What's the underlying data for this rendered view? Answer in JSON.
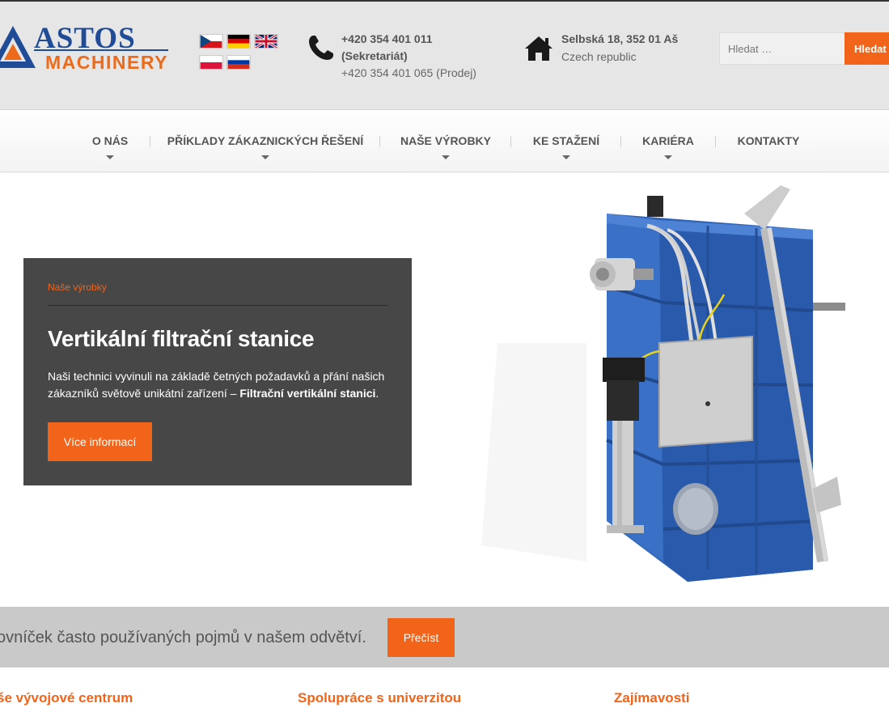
{
  "header": {
    "logo": {
      "line1": "ASTOS",
      "line2": "MACHINERY"
    },
    "flags": [
      "cz",
      "de",
      "gb",
      "pl",
      "ru"
    ],
    "phone": {
      "line1": "+420 354 401 011",
      "line2": "(Sekretariát)",
      "line3": "+420 354 401 065 (Prodej)"
    },
    "address": {
      "line1": "Selbská 18, 352 01 Aš",
      "line2": "Czech republic"
    },
    "search": {
      "placeholder": "Hledat …",
      "button": "Hledat"
    }
  },
  "nav": {
    "items": [
      {
        "label": "O NÁS",
        "dropdown": true
      },
      {
        "label": "PŘÍKLADY ZÁKAZNICKÝCH ŘEŠENÍ",
        "dropdown": true
      },
      {
        "label": "NAŠE VÝROBKY",
        "dropdown": true
      },
      {
        "label": "KE STAŽENÍ",
        "dropdown": true
      },
      {
        "label": "KARIÉRA",
        "dropdown": true
      },
      {
        "label": "KONTAKTY",
        "dropdown": false
      }
    ]
  },
  "hero": {
    "category": "Naše výrobky",
    "title": "Vertikální filtrační stanice",
    "text": "Naši technici vyvinuli na základě četných požadavků a přání našich zákazníků světově unikátní zařízení – ",
    "text_bold": "Filtrační vertikální stanici",
    "text_end": ".",
    "button": "Více informací"
  },
  "strip": {
    "text": "ovníček často používaných pojmů v našem odvětví.",
    "button": "Přečíst"
  },
  "footer_headings": [
    "še vývojové centrum",
    "Spolupráce s univerzitou",
    "Zajímavosti"
  ],
  "colors": {
    "accent": "#f26419",
    "brand_blue": "#1f4b97",
    "card": "#474747"
  }
}
